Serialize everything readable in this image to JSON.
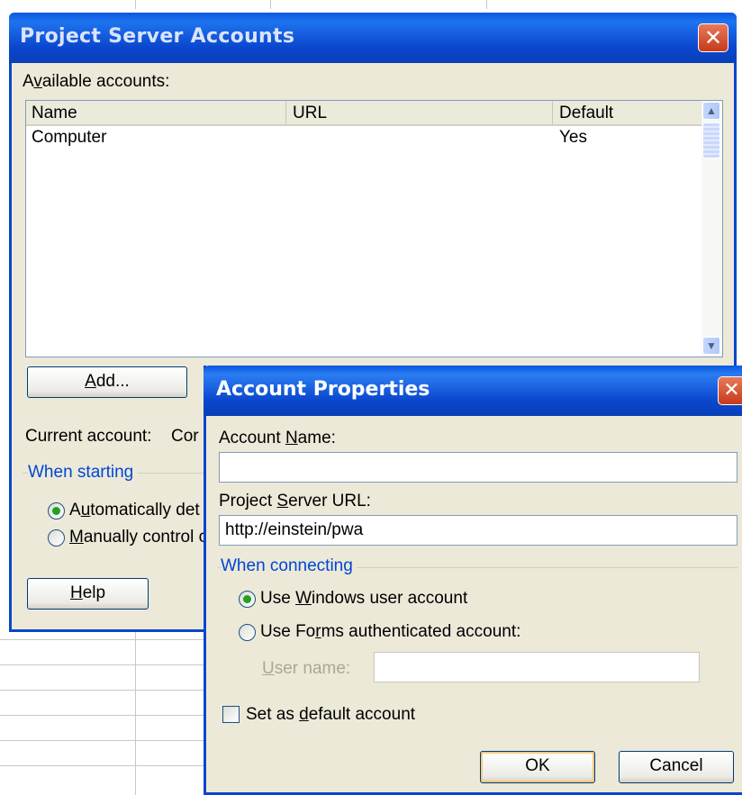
{
  "psa": {
    "title": "Project Server Accounts",
    "available_label_pre": "A",
    "available_label_u": "v",
    "available_label_post": "ailable accounts:",
    "columns": {
      "name": "Name",
      "url": "URL",
      "default": "Default"
    },
    "rows": [
      {
        "name": "Computer",
        "url": "",
        "default": "Yes"
      }
    ],
    "add_pre": "",
    "add_u": "A",
    "add_post": "dd...",
    "current_account_label": "Current account:",
    "current_account_value": "Cor",
    "when_starting": "When starting",
    "opt_auto_pre": "A",
    "opt_auto_u": "u",
    "opt_auto_post": "tomatically det",
    "opt_manual_pre": "",
    "opt_manual_u": "M",
    "opt_manual_post": "anually control c",
    "help_pre": "",
    "help_u": "H",
    "help_post": "elp"
  },
  "ap": {
    "title": "Account Properties",
    "account_name_pre": "Account ",
    "account_name_u": "N",
    "account_name_post": "ame:",
    "account_name_value": "",
    "server_url_pre": "Project ",
    "server_url_u": "S",
    "server_url_post": "erver URL:",
    "server_url_value": "http://einstein/pwa",
    "when_connecting": "When connecting",
    "opt_windows_pre": "Use ",
    "opt_windows_u": "W",
    "opt_windows_post": "indows user account",
    "opt_forms_pre": "Use Fo",
    "opt_forms_u": "r",
    "opt_forms_post": "ms authenticated account:",
    "username_pre": "",
    "username_u": "U",
    "username_post": "ser name:",
    "username_value": "",
    "default_pre": "Set as ",
    "default_u": "d",
    "default_post": "efault account",
    "default_checked": false,
    "windows_selected": true,
    "ok": "OK",
    "cancel": "Cancel"
  },
  "colors": {
    "xp_blue": "#0a46cd",
    "face": "#ece9d8",
    "group_text": "#0046d5"
  }
}
